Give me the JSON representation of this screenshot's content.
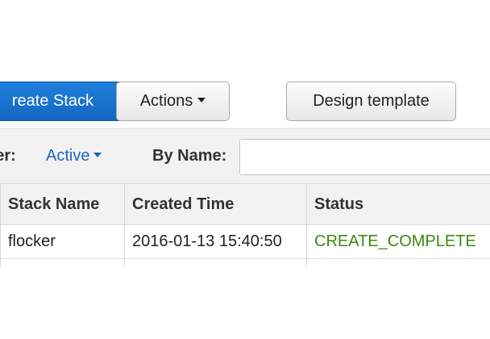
{
  "toolbar": {
    "create_stack_label": "reate Stack",
    "actions_label": "Actions",
    "design_template_label": "Design template"
  },
  "filter": {
    "label": "lter:",
    "value": "Active",
    "by_name_label": "By Name:",
    "by_name_value": ""
  },
  "table": {
    "headers": {
      "stack_name": "Stack Name",
      "created_time": "Created Time",
      "status": "Status"
    },
    "rows": [
      {
        "stack_name": "flocker",
        "created_time": "2016-01-13 15:40:50",
        "status": "CREATE_COMPLETE"
      }
    ]
  },
  "colors": {
    "primary_button": "#1467c3",
    "link": "#1a66b8",
    "status_complete": "#3c8a0e"
  }
}
